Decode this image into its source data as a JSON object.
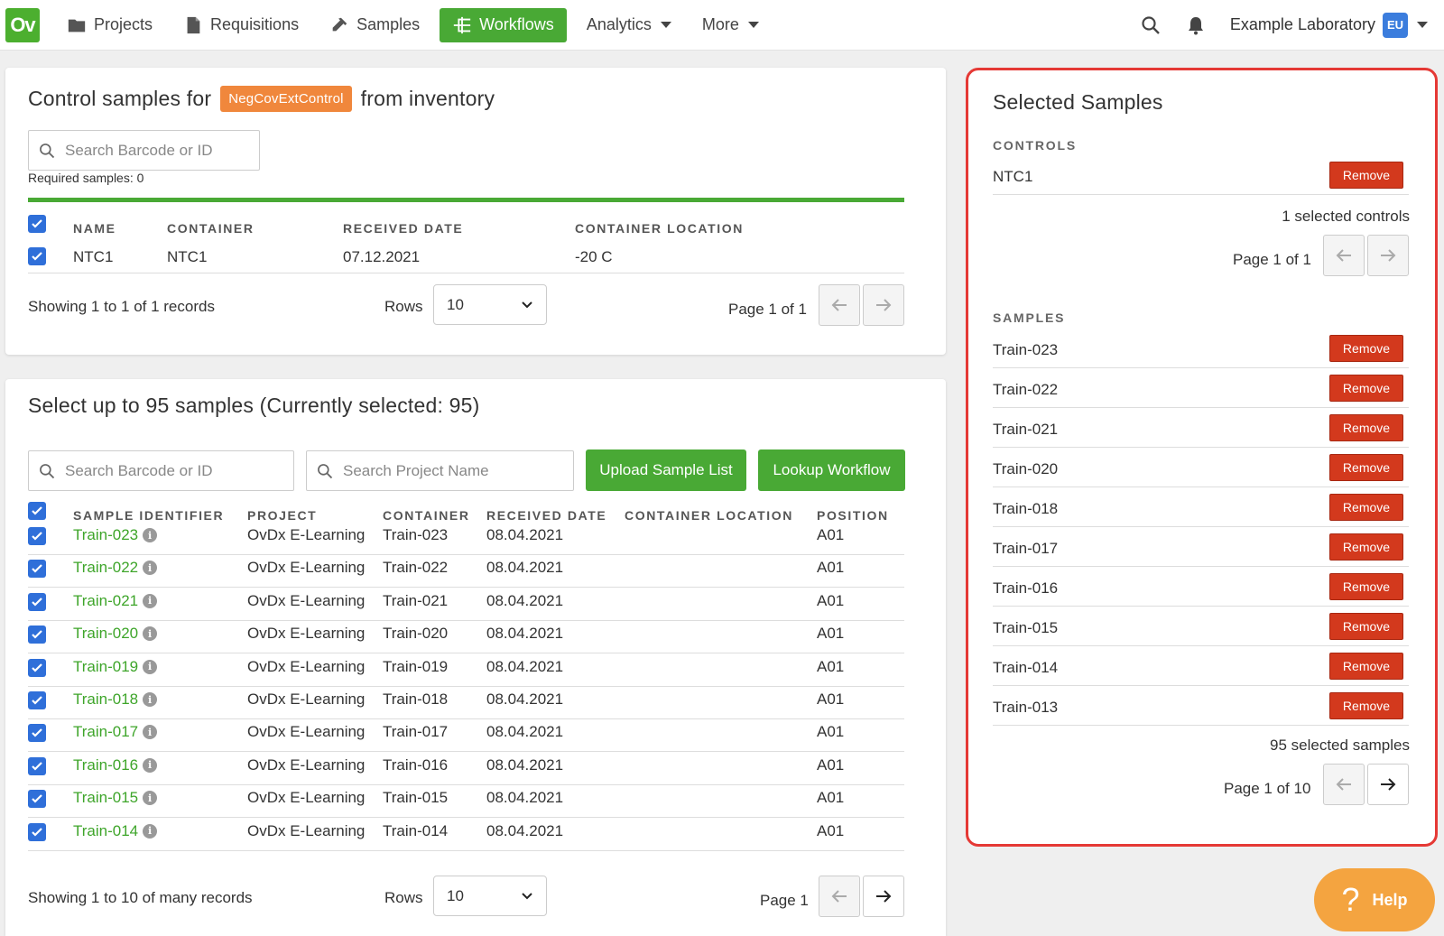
{
  "nav": {
    "logo": "Ov",
    "items": [
      {
        "label": "Projects",
        "icon": "folder-icon"
      },
      {
        "label": "Requisitions",
        "icon": "document-icon"
      },
      {
        "label": "Samples",
        "icon": "pipette-icon"
      },
      {
        "label": "Workflows",
        "icon": "workflow-icon",
        "active": true
      },
      {
        "label": "Analytics",
        "icon": "",
        "dropdown": true
      },
      {
        "label": "More",
        "icon": "",
        "dropdown": true
      }
    ],
    "lab_name": "Example Laboratory",
    "region_badge": "EU"
  },
  "controls_panel": {
    "title_prefix": "Control samples for",
    "tag": "NegCovExtControl",
    "title_suffix": "from inventory",
    "search_placeholder": "Search Barcode or ID",
    "required_text": "Required samples: 0",
    "columns": [
      "NAME",
      "CONTAINER",
      "RECEIVED DATE",
      "CONTAINER LOCATION"
    ],
    "rows": [
      {
        "name": "NTC1",
        "container": "NTC1",
        "received": "07.12.2021",
        "location": "-20 C"
      }
    ],
    "showing": "Showing 1 to 1 of 1 records",
    "rows_label": "Rows",
    "rows_value": "10",
    "page_text": "Page 1 of 1"
  },
  "samples_panel": {
    "title": "Select up to 95 samples (Currently selected: 95)",
    "search_barcode_placeholder": "Search Barcode or ID",
    "search_project_placeholder": "Search Project Name",
    "upload_label": "Upload Sample List",
    "lookup_label": "Lookup Workflow",
    "columns": [
      "SAMPLE IDENTIFIER",
      "PROJECT",
      "CONTAINER",
      "RECEIVED DATE",
      "CONTAINER LOCATION",
      "POSITION"
    ],
    "rows": [
      {
        "id": "Train-023",
        "project": "OvDx E-Learning",
        "container": "Train-023",
        "received": "08.04.2021",
        "location": "",
        "position": "A01"
      },
      {
        "id": "Train-022",
        "project": "OvDx E-Learning",
        "container": "Train-022",
        "received": "08.04.2021",
        "location": "",
        "position": "A01"
      },
      {
        "id": "Train-021",
        "project": "OvDx E-Learning",
        "container": "Train-021",
        "received": "08.04.2021",
        "location": "",
        "position": "A01"
      },
      {
        "id": "Train-020",
        "project": "OvDx E-Learning",
        "container": "Train-020",
        "received": "08.04.2021",
        "location": "",
        "position": "A01"
      },
      {
        "id": "Train-019",
        "project": "OvDx E-Learning",
        "container": "Train-019",
        "received": "08.04.2021",
        "location": "",
        "position": "A01"
      },
      {
        "id": "Train-018",
        "project": "OvDx E-Learning",
        "container": "Train-018",
        "received": "08.04.2021",
        "location": "",
        "position": "A01"
      },
      {
        "id": "Train-017",
        "project": "OvDx E-Learning",
        "container": "Train-017",
        "received": "08.04.2021",
        "location": "",
        "position": "A01"
      },
      {
        "id": "Train-016",
        "project": "OvDx E-Learning",
        "container": "Train-016",
        "received": "08.04.2021",
        "location": "",
        "position": "A01"
      },
      {
        "id": "Train-015",
        "project": "OvDx E-Learning",
        "container": "Train-015",
        "received": "08.04.2021",
        "location": "",
        "position": "A01"
      },
      {
        "id": "Train-014",
        "project": "OvDx E-Learning",
        "container": "Train-014",
        "received": "08.04.2021",
        "location": "",
        "position": "A01"
      }
    ],
    "showing": "Showing 1 to 10 of many records",
    "rows_label": "Rows",
    "rows_value": "10",
    "page_text": "Page 1"
  },
  "selected_panel": {
    "title": "Selected Samples",
    "controls_heading": "CONTROLS",
    "controls": [
      "NTC1"
    ],
    "controls_count": "1 selected controls",
    "controls_page": "Page 1 of 1",
    "samples_heading": "SAMPLES",
    "samples": [
      "Train-023",
      "Train-022",
      "Train-021",
      "Train-020",
      "Train-018",
      "Train-017",
      "Train-016",
      "Train-015",
      "Train-014",
      "Train-013"
    ],
    "samples_count": "95 selected samples",
    "samples_page": "Page 1 of 10",
    "remove_label": "Remove"
  },
  "help": {
    "icon": "?",
    "label": "Help"
  },
  "colors": {
    "brand_green": "#49a935",
    "tag_orange": "#f0873c",
    "remove_red": "#d3391d",
    "highlight_border": "#e53935",
    "checkbox_blue": "#2f6fd9"
  }
}
